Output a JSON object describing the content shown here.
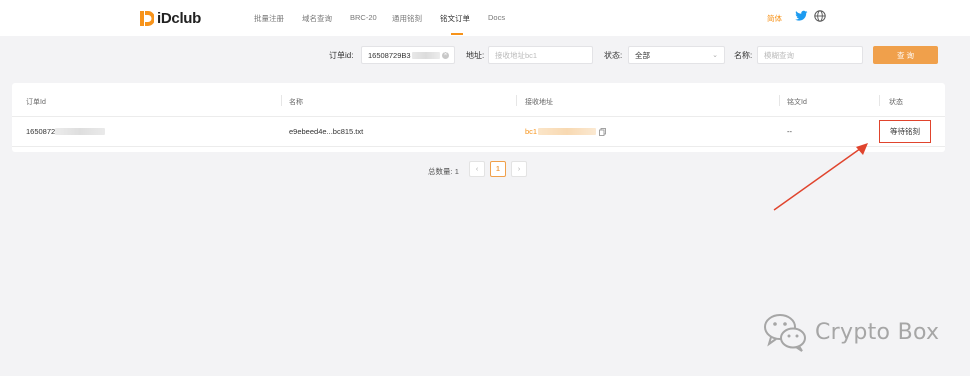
{
  "header": {
    "brand": "iDclub",
    "nav": [
      {
        "label": "批量注册"
      },
      {
        "label": "域名查询"
      },
      {
        "label": "BRC-20"
      },
      {
        "label": "通用铭刻"
      },
      {
        "label": "铭文订单",
        "active": true
      },
      {
        "label": "Docs"
      }
    ],
    "lang_label": "简体",
    "icons": [
      "twitter-icon",
      "globe-icon"
    ],
    "accent_color": "#f7931a"
  },
  "filters": {
    "order_id_label": "订单id:",
    "order_id_value": "16508729B3",
    "address_label": "地址:",
    "address_placeholder": "接收地址bc1",
    "status_label": "状态:",
    "status_value": "全部",
    "name_label": "名称:",
    "name_placeholder": "模糊查询",
    "search_button": "查 询"
  },
  "table": {
    "columns": [
      "订单Id",
      "名称",
      "接收地址",
      "铭文Id",
      "状态"
    ],
    "rows": [
      {
        "order_id": "1650872",
        "name": "e9ebeed4e...bc815.txt",
        "address": "bc1",
        "inscription_id": "--",
        "status": "等待铭刻"
      }
    ]
  },
  "pagination": {
    "total_label": "总数量:",
    "total_value": "1",
    "current_page": "1",
    "prev": "‹",
    "next": "›"
  },
  "annotation": {
    "arrow_color": "#e0442d"
  },
  "watermark": {
    "text": "Crypto Box"
  }
}
